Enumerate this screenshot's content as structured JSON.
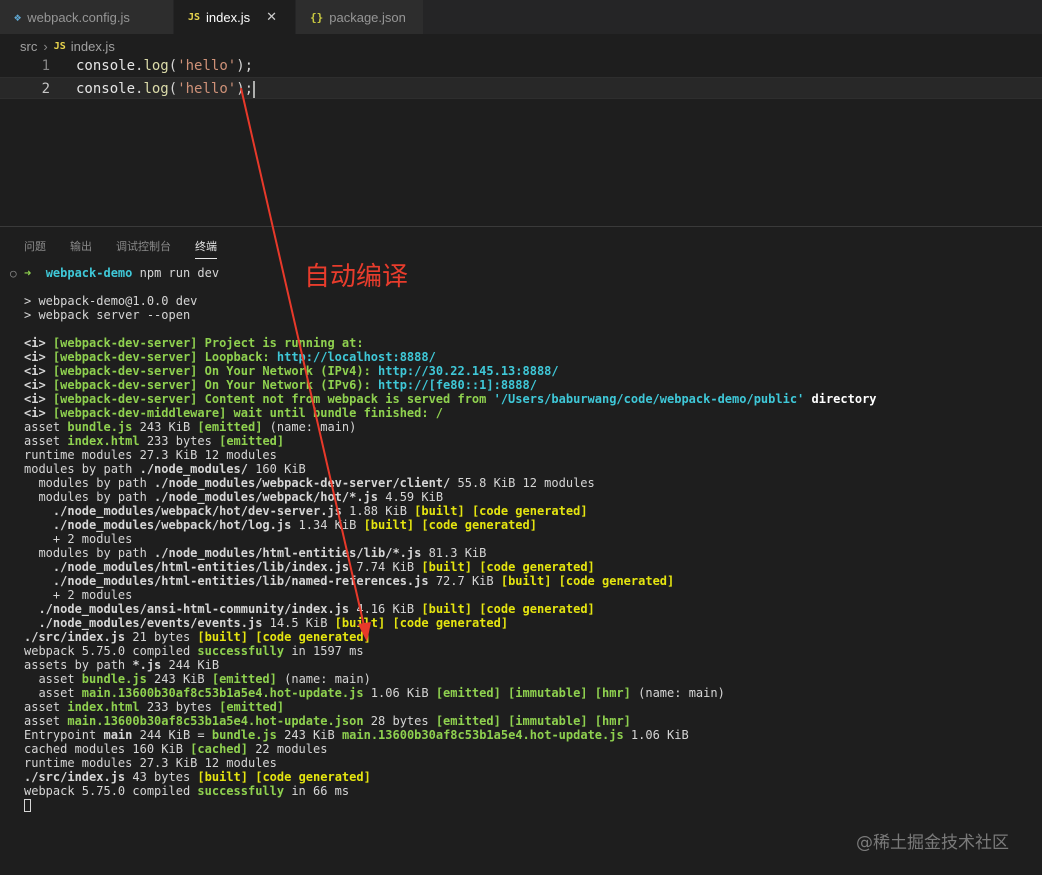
{
  "tabs": [
    {
      "label": "webpack.config.js",
      "icon": "webpack-icon"
    },
    {
      "label": "index.js",
      "icon": "js-icon",
      "active": true
    },
    {
      "label": "package.json",
      "icon": "json-icon"
    }
  ],
  "tab_icons": {
    "js": "JS",
    "json": "{}"
  },
  "breadcrumb": {
    "folder": "src",
    "file": "index.js"
  },
  "editor": {
    "lines": [
      {
        "num": "1",
        "obj": "console",
        "dot": ".",
        "fn": "log",
        "open": "(",
        "str": "'hello'",
        "close": ");"
      },
      {
        "num": "2",
        "obj": "console",
        "dot": ".",
        "fn": "log",
        "open": "(",
        "str": "'hello'",
        "close": ");"
      }
    ]
  },
  "panel_tabs": [
    "问题",
    "输出",
    "调试控制台",
    "终端"
  ],
  "annotation": "自动编译",
  "terminal": {
    "prompt": {
      "arrow": "➜",
      "dir": "webpack-demo",
      "cmd": "npm run dev"
    },
    "l1": "> webpack-demo@1.0.0 dev",
    "l2": "> webpack server --open",
    "l3": {
      "a": "<i> ",
      "b": "[webpack-dev-server] Project is running at:"
    },
    "l4": {
      "a": "<i> ",
      "b": "[webpack-dev-server] Loopback: ",
      "c": "http://localhost:8888/"
    },
    "l5": {
      "a": "<i> ",
      "b": "[webpack-dev-server] On Your Network (IPv4): ",
      "c": "http://30.22.145.13:8888/"
    },
    "l6": {
      "a": "<i> ",
      "b": "[webpack-dev-server] On Your Network (IPv6): ",
      "c": "http://[fe80::1]:8888/"
    },
    "l7": {
      "a": "<i> ",
      "b": "[webpack-dev-server] Content not from webpack is served from ",
      "c": "'/Users/baburwang/code/webpack-demo/public'",
      "d": " directory"
    },
    "l8": {
      "a": "<i> ",
      "b": "[webpack-dev-middleware] wait until bundle finished: /"
    },
    "l9": {
      "a": "asset ",
      "b": "bundle.js",
      "c": " 243 KiB ",
      "d": "[emitted]",
      "e": " (name: main)"
    },
    "l10": {
      "a": "asset ",
      "b": "index.html",
      "c": " 233 bytes ",
      "d": "[emitted]"
    },
    "l11": "runtime modules 27.3 KiB 12 modules",
    "l12": {
      "a": "modules by path ",
      "b": "./node_modules/",
      "c": " 160 KiB"
    },
    "l13": {
      "a": "  modules by path ",
      "b": "./node_modules/webpack-dev-server/client/",
      "c": " 55.8 KiB 12 modules"
    },
    "l14": {
      "a": "  modules by path ",
      "b": "./node_modules/webpack/hot/*.js",
      "c": " 4.59 KiB"
    },
    "l15": {
      "a": "    ",
      "b": "./node_modules/webpack/hot/dev-server.js",
      "c": " 1.88 KiB ",
      "d": "[built]",
      "e": " ",
      "f": "[code generated]"
    },
    "l16": {
      "a": "    ",
      "b": "./node_modules/webpack/hot/log.js",
      "c": " 1.34 KiB ",
      "d": "[built]",
      "e": " ",
      "f": "[code generated]"
    },
    "l17": "    + 2 modules",
    "l18": {
      "a": "  modules by path ",
      "b": "./node_modules/html-entities/lib/*.js",
      "c": " 81.3 KiB"
    },
    "l19": {
      "a": "    ",
      "b": "./node_modules/html-entities/lib/index.js",
      "c": " 7.74 KiB ",
      "d": "[built]",
      "e": " ",
      "f": "[code generated]"
    },
    "l20": {
      "a": "    ",
      "b": "./node_modules/html-entities/lib/named-references.js",
      "c": " 72.7 KiB ",
      "d": "[built]",
      "e": " ",
      "f": "[code generated]"
    },
    "l21": "    + 2 modules",
    "l22": {
      "a": "  ",
      "b": "./node_modules/ansi-html-community/index.js",
      "c": " 4.16 KiB ",
      "d": "[built]",
      "e": " ",
      "f": "[code generated]"
    },
    "l23": {
      "a": "  ",
      "b": "./node_modules/events/events.js",
      "c": " 14.5 KiB ",
      "d": "[built]",
      "e": " ",
      "f": "[code generated]"
    },
    "l24": {
      "b": "./src/index.js",
      "c": " 21 bytes ",
      "d": "[built]",
      "e": " ",
      "f": "[code generated]"
    },
    "l25": {
      "a": "webpack 5.75.0 compiled ",
      "b": "successfully",
      "c": " in 1597 ms"
    },
    "l26": {
      "a": "assets by path ",
      "b": "*.js",
      "c": " 244 KiB"
    },
    "l27": {
      "a": "  asset ",
      "b": "bundle.js",
      "c": " 243 KiB ",
      "d": "[emitted]",
      "e": " (name: main)"
    },
    "l28": {
      "a": "  asset ",
      "b": "main.13600b30af8c53b1a5e4.hot-update.js",
      "c": " 1.06 KiB ",
      "d": "[emitted] [immutable] [hmr]",
      "e": " (name: main)"
    },
    "l29": {
      "a": "asset ",
      "b": "index.html",
      "c": " 233 bytes ",
      "d": "[emitted]"
    },
    "l30": {
      "a": "asset ",
      "b": "main.13600b30af8c53b1a5e4.hot-update.json",
      "c": " 28 bytes ",
      "d": "[emitted] [immutable] [hmr]"
    },
    "l31": {
      "a": "Entrypoint ",
      "b": "main",
      "c": " 244 KiB = ",
      "d": "bundle.js",
      "e": " 243 KiB ",
      "f": "main.13600b30af8c53b1a5e4.hot-update.js",
      "g": " 1.06 KiB"
    },
    "l32": {
      "a": "cached modules 160 KiB ",
      "b": "[cached]",
      "c": " 22 modules"
    },
    "l33": "runtime modules 27.3 KiB 12 modules",
    "l34": {
      "b": "./src/index.js",
      "c": " 43 bytes ",
      "d": "[built]",
      "e": " ",
      "f": "[code generated]"
    },
    "l35": {
      "a": "webpack 5.75.0 compiled ",
      "b": "successfully",
      "c": " in 66 ms"
    }
  },
  "watermark": "@稀土掘金技术社区"
}
